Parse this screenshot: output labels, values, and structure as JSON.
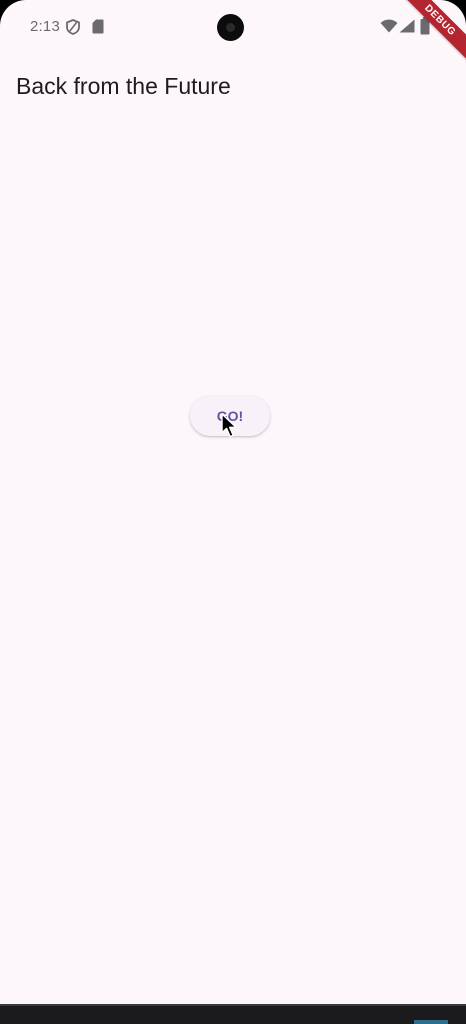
{
  "status_bar": {
    "time": "2:13",
    "icons": [
      "shield-icon",
      "sd-card-icon",
      "wifi-icon",
      "signal-icon",
      "battery-icon"
    ]
  },
  "debug_banner": {
    "label": "DEBUG",
    "color": "#b3262f"
  },
  "app_bar": {
    "title": "Back from the Future"
  },
  "main": {
    "go_button_label": "GO!"
  },
  "colors": {
    "background": "#fdf7fb",
    "accent": "#6750a4",
    "title_text": "#1d1b20"
  }
}
